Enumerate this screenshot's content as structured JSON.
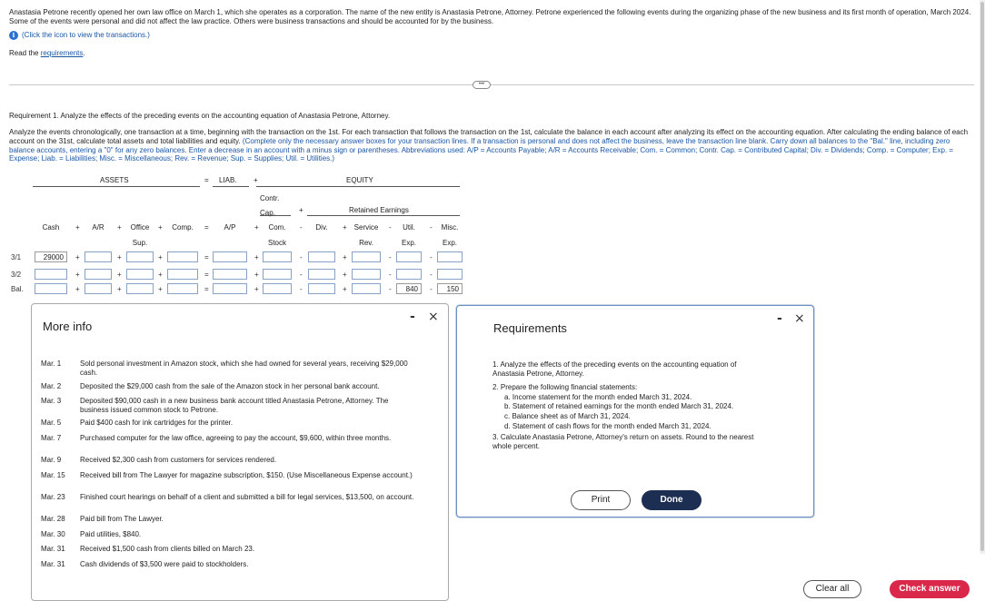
{
  "intro": {
    "paragraph": "Anastasia Petrone recently opened her own law office on March 1, which she operates as a corporation. The name of the new entity is Anastasia Petrone, Attorney. Petrone experienced the following events during the organizing phase of the new business and its first month of operation, March 2024. Some of the events were personal and did not affect the law practice. Others were business transactions and should be accounted for by the business.",
    "click_text": "(Click the icon to view the transactions.)",
    "read_prefix": "Read the ",
    "read_link": "requirements",
    "read_suffix": "."
  },
  "requirement1": {
    "heading": "Requirement 1. Analyze the effects of the preceding events on the accounting equation of Anastasia Petrone, Attorney.",
    "instructions": "Analyze the events chronologically, one transaction at a time, beginning with the transaction on the 1st. For each transaction that follows the transaction on the 1st, calculate the balance in each account after analyzing its effect on the accounting equation. After calculating the ending balance of each account on the 31st, calculate total assets and total liabilities and equity.",
    "hint": "(Complete only the necessary answer boxes for your transaction lines. If a transaction is personal and does not affect the business, leave the transaction line blank. Carry down all balances to the \"Bal.\" line, including zero balance accounts, entering a \"0\" for any zero balances. Enter a decrease in an account with a minus sign or parentheses. Abbreviations used: A/P = Accounts Payable; A/R = Accounts Receivable; Com. = Common; Contr. Cap. = Contributed Capital; Div. = Dividends; Comp. = Computer; Exp. = Expense; Liab. = Liabilities; Misc. = Miscellaneous; Rev. = Revenue; Sup. = Supplies; Util. = Utilities.)"
  },
  "equation": {
    "assets_label": "ASSETS",
    "eq_sign": "=",
    "liab_label": "LIAB.",
    "plus": "+",
    "equity_label": "EQUITY",
    "contr_cap": "Contr. Cap.",
    "retained_earnings": "Retained Earnings",
    "columns": [
      {
        "line1": "Cash",
        "line2": ""
      },
      {
        "line1": "A/R",
        "line2": ""
      },
      {
        "line1": "Office",
        "line2": "Sup."
      },
      {
        "line1": "Comp.",
        "line2": ""
      },
      {
        "line1": "A/P",
        "line2": ""
      },
      {
        "line1": "Com.",
        "line2": "Stock"
      },
      {
        "line1": "Div.",
        "line2": ""
      },
      {
        "line1": "Service",
        "line2": "Rev."
      },
      {
        "line1": "Util.",
        "line2": "Exp."
      },
      {
        "line1": "Misc.",
        "line2": "Exp."
      }
    ],
    "operators": [
      "+",
      "+",
      "+",
      "=",
      "+",
      "-",
      "+",
      "-",
      "-"
    ],
    "rows": [
      {
        "label": "3/1",
        "values": [
          "29000",
          "",
          "",
          "",
          "",
          "",
          "",
          "",
          "",
          ""
        ]
      },
      {
        "label": "3/2",
        "values": [
          "",
          "",
          "",
          "",
          "",
          "",
          "",
          "",
          "",
          ""
        ]
      },
      {
        "label": "Bal.",
        "values": [
          "",
          "",
          "",
          "",
          "",
          "",
          "",
          "",
          "840",
          "150"
        ]
      }
    ]
  },
  "more_info": {
    "title": "More info",
    "events": [
      {
        "date": "Mar. 1",
        "text": "Sold personal investment in Amazon stock, which she had owned for several years, receiving $29,000 cash."
      },
      {
        "date": "Mar. 2",
        "text": "Deposited the $29,000 cash from the sale of the Amazon stock in her personal bank account."
      },
      {
        "date": "Mar. 3",
        "text": "Deposited $90,000 cash in a new business bank account titled Anastasia Petrone, Attorney. The business issued common stock to Petrone."
      },
      {
        "date": "Mar. 5",
        "text": "Paid $400 cash for ink cartridges for the printer."
      },
      {
        "date": "Mar. 7",
        "text": "Purchased computer for the law office, agreeing to pay the account, $9,600, within three months."
      },
      {
        "date": "Mar. 9",
        "text": "Received $2,300 cash from customers for services rendered."
      },
      {
        "date": "Mar. 15",
        "text": "Received bill from The Lawyer for magazine subscription, $150. (Use Miscellaneous Expense account.)"
      },
      {
        "date": "Mar. 23",
        "text": "Finished court hearings on behalf of a client and submitted a bill for legal services, $13,500, on account."
      },
      {
        "date": "Mar. 28",
        "text": "Paid bill from The Lawyer."
      },
      {
        "date": "Mar. 30",
        "text": "Paid utilities, $840."
      },
      {
        "date": "Mar. 31",
        "text": "Received $1,500 cash from clients billed on March 23."
      },
      {
        "date": "Mar. 31",
        "text": "Cash dividends of $3,500 were paid to stockholders."
      }
    ]
  },
  "requirements_panel": {
    "title": "Requirements",
    "items": [
      "1. Analyze the effects of the preceding events on the accounting equation of Anastasia Petrone, Attorney.",
      "2. Prepare the following financial statements:",
      "a. Income statement for the month ended March 31, 2024.",
      "b. Statement of retained earnings for the month ended March 31, 2024.",
      "c. Balance sheet as of March 31, 2024.",
      "d. Statement of cash flows for the month ended March 31, 2024.",
      "3. Calculate Anastasia Petrone, Attorney's return on assets. Round to the nearest whole percent."
    ],
    "print_label": "Print",
    "done_label": "Done"
  },
  "panel_controls": {
    "minimize": "-",
    "close": "×"
  },
  "footer": {
    "clear_all": "Clear all",
    "check_answer": "Check answer"
  },
  "icons": {
    "info": "info-icon",
    "expand": "more-dots-icon"
  },
  "colors": {
    "accent_link": "#1a56a6",
    "check_answer": "#d9284a",
    "done_button": "#1c2e52"
  }
}
